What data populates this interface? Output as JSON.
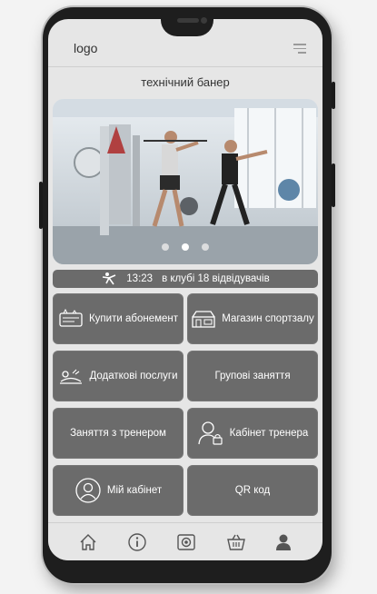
{
  "header": {
    "logo": "logo"
  },
  "banner": {
    "title": "технічний банер",
    "slides": 3,
    "active_slide": 2
  },
  "status": {
    "time": "13:23",
    "text": "в клубі 18 відвідувачів"
  },
  "tiles": [
    {
      "label": "Купити абонемент",
      "icon": "ticket-icon"
    },
    {
      "label": "Магазин спортзалу",
      "icon": "shop-icon"
    },
    {
      "label": "Додаткові послуги",
      "icon": "massage-icon"
    },
    {
      "label": "Групові заняття",
      "icon": ""
    },
    {
      "label": "Заняття з тренером",
      "icon": ""
    },
    {
      "label": "Кабінет тренера",
      "icon": "trainer-lock-icon"
    },
    {
      "label": "Мій кабінет",
      "icon": "user-circle-icon"
    },
    {
      "label": "QR код",
      "icon": ""
    }
  ],
  "nav": [
    "home-icon",
    "info-icon",
    "camera-icon",
    "basket-icon",
    "profile-icon"
  ]
}
